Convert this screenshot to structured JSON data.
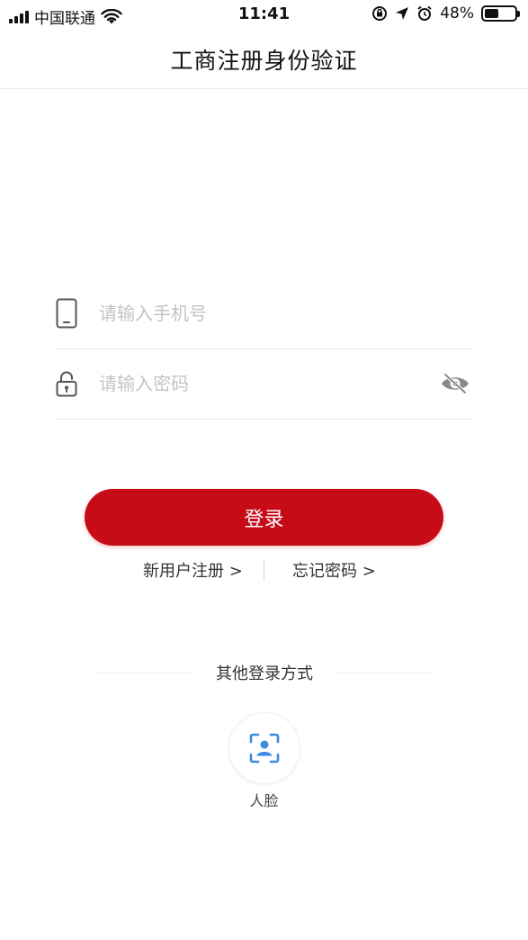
{
  "status_bar": {
    "carrier": "中国联通",
    "time": "11:41",
    "battery_percent": "48%",
    "battery_level": 0.48
  },
  "nav": {
    "title": "工商注册身份验证"
  },
  "form": {
    "phone_placeholder": "请输入手机号",
    "password_placeholder": "请输入密码"
  },
  "login_button": {
    "label": "登录"
  },
  "links": {
    "register": "新用户注册 >",
    "forgot": "忘记密码 >"
  },
  "other_login": {
    "label": "其他登录方式",
    "face_label": "人脸"
  },
  "colors": {
    "accent": "#c70c18",
    "face_icon": "#3f8ae0"
  },
  "icons": {
    "phone": "phone-icon",
    "lock": "lock-icon",
    "eye_off": "eye-off-icon",
    "face": "face-scan-icon",
    "wifi": "wifi-icon",
    "signal": "signal-icon"
  }
}
